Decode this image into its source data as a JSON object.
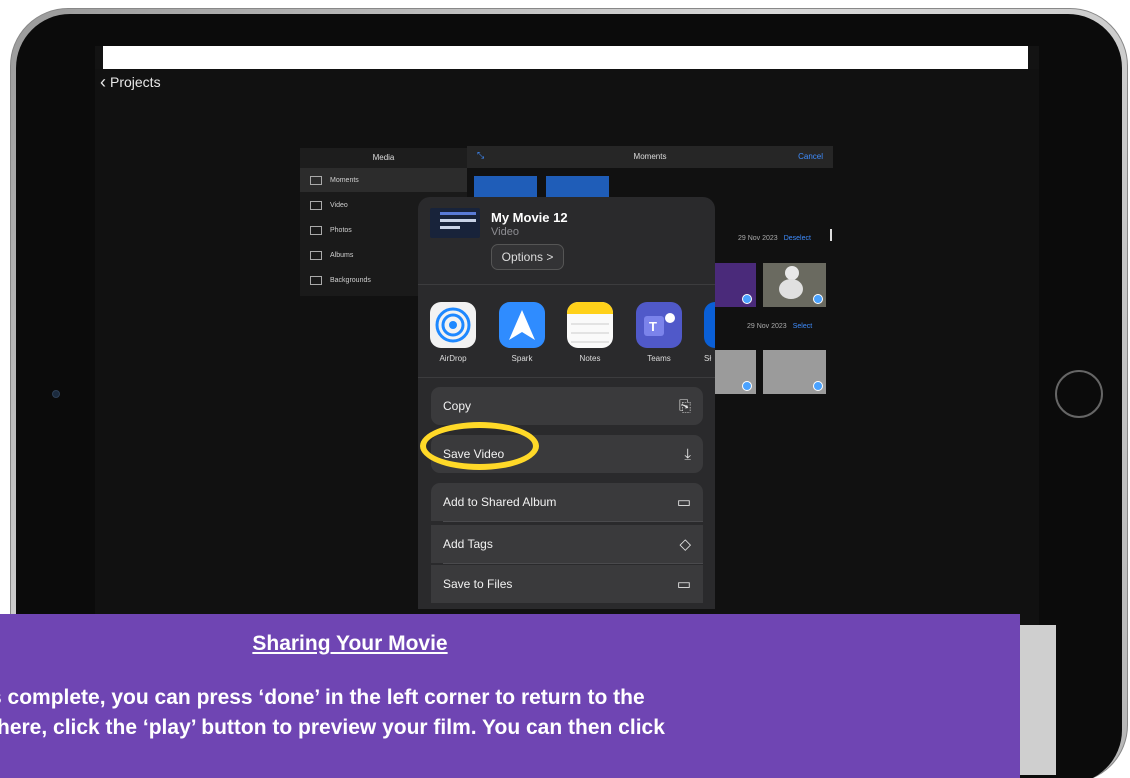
{
  "nav": {
    "back_label": "Projects"
  },
  "media_panel": {
    "title": "Media",
    "items": [
      {
        "label": "Moments",
        "selected": true,
        "icon": "moments-icon"
      },
      {
        "label": "Video",
        "selected": false,
        "icon": "film-icon"
      },
      {
        "label": "Photos",
        "selected": false,
        "icon": "photos-icon"
      },
      {
        "label": "Albums",
        "selected": false,
        "icon": "albums-icon"
      },
      {
        "label": "Backgrounds",
        "selected": false,
        "icon": "backgrounds-icon"
      }
    ]
  },
  "moments": {
    "title": "Moments",
    "cancel_label": "Cancel",
    "groups": [
      {
        "date": "29 Nov 2023",
        "action": "Deselect"
      },
      {
        "date": "29 Nov 2023",
        "action": "Select"
      }
    ]
  },
  "share_sheet": {
    "title": "My Movie 12",
    "subtitle": "Video",
    "options_label": "Options >",
    "apps": [
      {
        "label": "AirDrop",
        "icon": "airdrop-icon"
      },
      {
        "label": "Spark",
        "icon": "spark-icon"
      },
      {
        "label": "Notes",
        "icon": "notes-icon"
      },
      {
        "label": "Teams",
        "icon": "teams-icon"
      },
      {
        "label": "Sł",
        "icon": "app-icon"
      }
    ],
    "actions": [
      {
        "label": "Copy",
        "icon": "copy-icon"
      },
      {
        "label": "Save Video",
        "icon": "save-icon"
      },
      {
        "label": "Add to Shared Album",
        "icon": "shared-album-icon"
      },
      {
        "label": "Add Tags",
        "icon": "tag-icon"
      },
      {
        "label": "Save to Files",
        "icon": "folder-icon"
      }
    ]
  },
  "caption": {
    "title": "Sharing Your Movie",
    "line1": "s complete, you can press ‘done’ in the left corner to return to the",
    "line2": " there, click the ‘play’ button to preview your film. You can then click"
  },
  "colors": {
    "accent": "#3f8dff",
    "panel": "#6f45b3",
    "highlight": "#ffd928"
  }
}
